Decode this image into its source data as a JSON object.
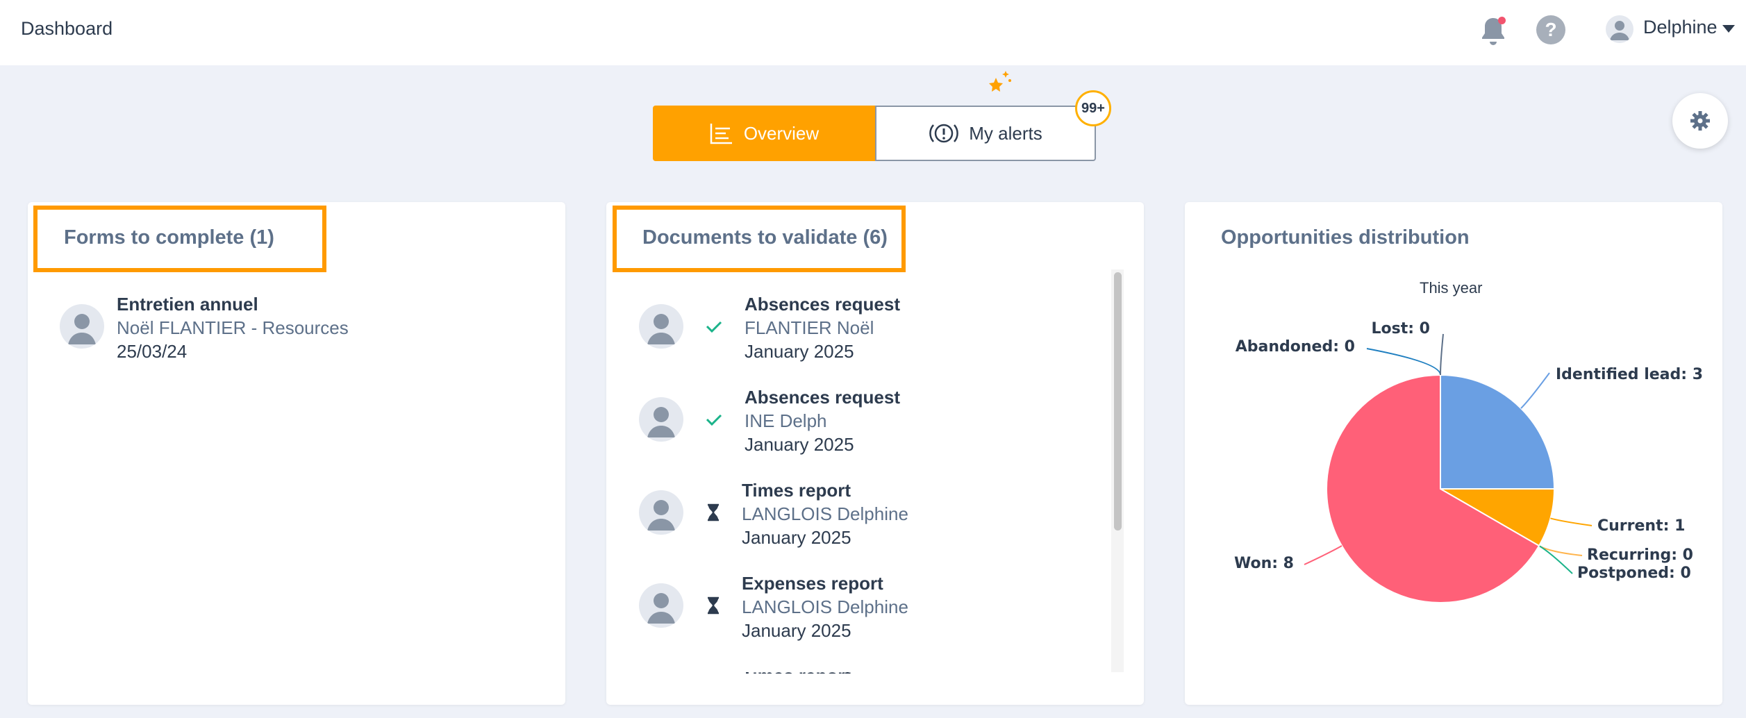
{
  "header": {
    "title": "Dashboard",
    "user_name": "Delphine",
    "help_glyph": "?"
  },
  "tabs": {
    "overview_label": "Overview",
    "alerts_label": "My alerts",
    "alerts_badge": "99+",
    "active": "Overview"
  },
  "forms": {
    "title": "Forms to complete (1)",
    "items": [
      {
        "title": "Entretien annuel",
        "subtitle": "Noël FLANTIER - Resources",
        "date": "25/03/24"
      }
    ]
  },
  "documents": {
    "title": "Documents to validate (6)",
    "items": [
      {
        "title": "Absences request",
        "person": "FLANTIER Noël",
        "date": "January 2025",
        "status": "check-icon"
      },
      {
        "title": "Absences request",
        "person": "INE Delph",
        "date": "January 2025",
        "status": "check-icon"
      },
      {
        "title": "Times report",
        "person": "LANGLOIS Delphine",
        "date": "January 2025",
        "status": "hourglass-icon"
      },
      {
        "title": "Expenses report",
        "person": "LANGLOIS Delphine",
        "date": "January 2025",
        "status": "hourglass-icon"
      },
      {
        "title": "Times report",
        "person": "",
        "date": "",
        "status": ""
      }
    ]
  },
  "opportunities": {
    "title": "Opportunities distribution"
  },
  "colors": {
    "accent": "#ffa100",
    "highlight": "#ff9a00",
    "check": "#1bb38a",
    "badge_border": "#ffb000",
    "notif_dot": "#f2546e"
  },
  "chart_data": {
    "type": "pie",
    "subtitle": "This year",
    "slices": [
      {
        "label": "Identified lead",
        "value": 3,
        "color": "#6a9fe3",
        "display": "Identified lead: 3"
      },
      {
        "label": "Current",
        "value": 1,
        "color": "#ffa500",
        "display": "Current: 1"
      },
      {
        "label": "Recurring",
        "value": 0,
        "color": "#ffb44c",
        "display": "Recurring: 0"
      },
      {
        "label": "Postponed",
        "value": 0,
        "color": "#1bb38a",
        "display": "Postponed: 0"
      },
      {
        "label": "Won",
        "value": 8,
        "color": "#ff6078",
        "display": "Won: 8"
      },
      {
        "label": "Abandoned",
        "value": 0,
        "color": "#1f7fc0",
        "display": "Abandoned: 0"
      },
      {
        "label": "Lost",
        "value": 0,
        "color": "#5d7089",
        "display": "Lost: 0"
      }
    ]
  }
}
